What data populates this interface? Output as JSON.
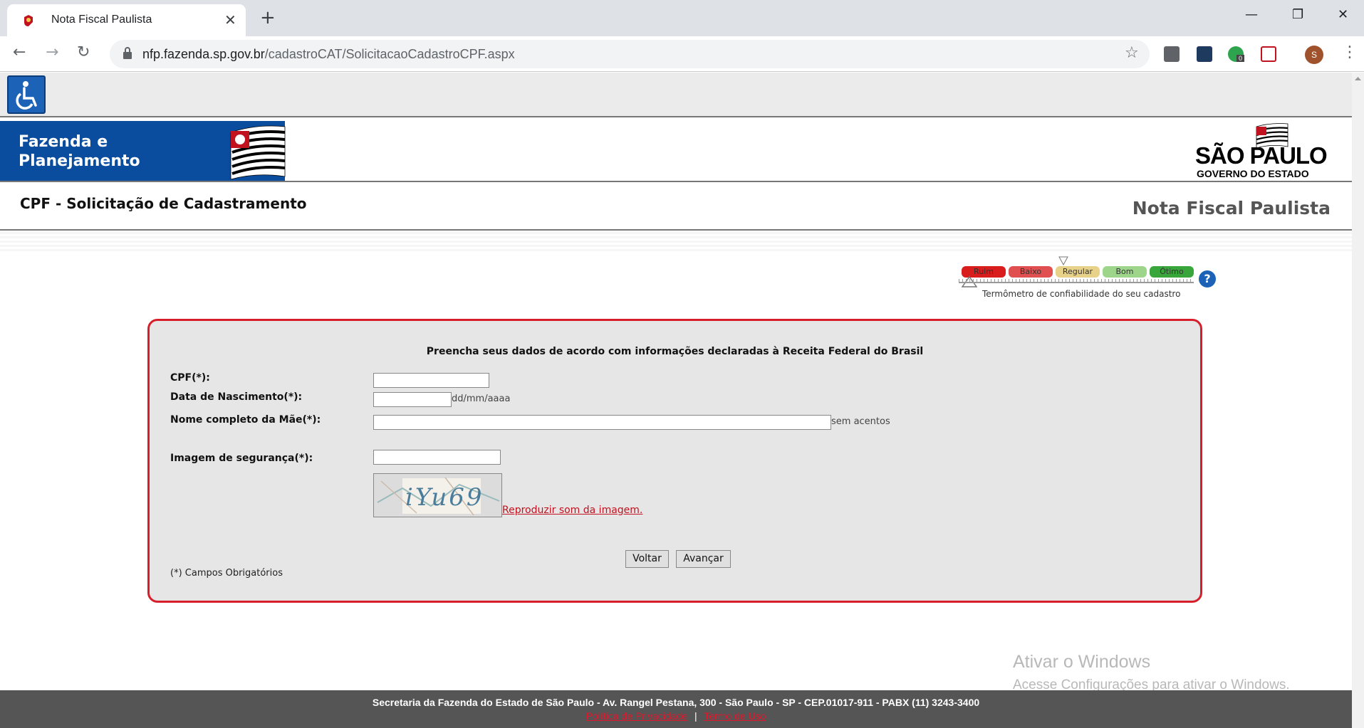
{
  "browser": {
    "tab_title": "Nota Fiscal Paulista",
    "tab_close": "✕",
    "new_tab": "+",
    "url_domain": "nfp.fazenda.sp.gov.br",
    "url_path": "/cadastroCAT/SolicitacaoCadastroCPF.aspx",
    "profile_initial": "S",
    "extension_badge": "0",
    "window_controls": {
      "minimize": "—",
      "restore": "❐",
      "close": "✕"
    }
  },
  "header": {
    "agency_line1": "Fazenda e",
    "agency_line2": "Planejamento",
    "state_logo_name": "SÃO PAULO",
    "state_logo_sub": "GOVERNO DO ESTADO"
  },
  "title_bar": {
    "page_title": "CPF - Solicitação de Cadastramento",
    "brand_title": "Nota Fiscal Paulista"
  },
  "thermometer": {
    "levels": [
      "Ruim",
      "Baixo",
      "Regular",
      "Bom",
      "Ótimo"
    ],
    "colors": [
      "#d91c1c",
      "#e05050",
      "#e8d28a",
      "#9dd68a",
      "#38a63a"
    ],
    "caption": "Termômetro de confiabilidade do seu cadastro",
    "help": "?"
  },
  "form": {
    "heading": "Preencha seus dados de acordo com informações declaradas à Receita Federal do Brasil",
    "cpf_label": "CPF(*):",
    "cpf_value": "",
    "birth_label": "Data de Nascimento(*):",
    "birth_value": "",
    "birth_hint": "dd/mm/aaaa",
    "mother_label": "Nome completo da Mãe(*):",
    "mother_value": "",
    "mother_hint": "sem acentos",
    "captcha_label": "Imagem de segurança(*):",
    "captcha_value": "",
    "captcha_text": "iYu69",
    "audio_link": "Reproduzir som da imagem.",
    "back_button": "Voltar",
    "next_button": "Avançar",
    "required_note": "(*) Campos Obrigatórios"
  },
  "watermark": {
    "line1": "Ativar o Windows",
    "line2": "Acesse Configurações para ativar o Windows."
  },
  "footer": {
    "address": "Secretaria da Fazenda do Estado de São Paulo - Av. Rangel Pestana, 300 - São Paulo - SP - CEP.01017-911 - PABX (11) 3243-3400",
    "privacy_link": "Política de Privacidade",
    "separator": "|",
    "terms_link": "Termo de Uso"
  }
}
